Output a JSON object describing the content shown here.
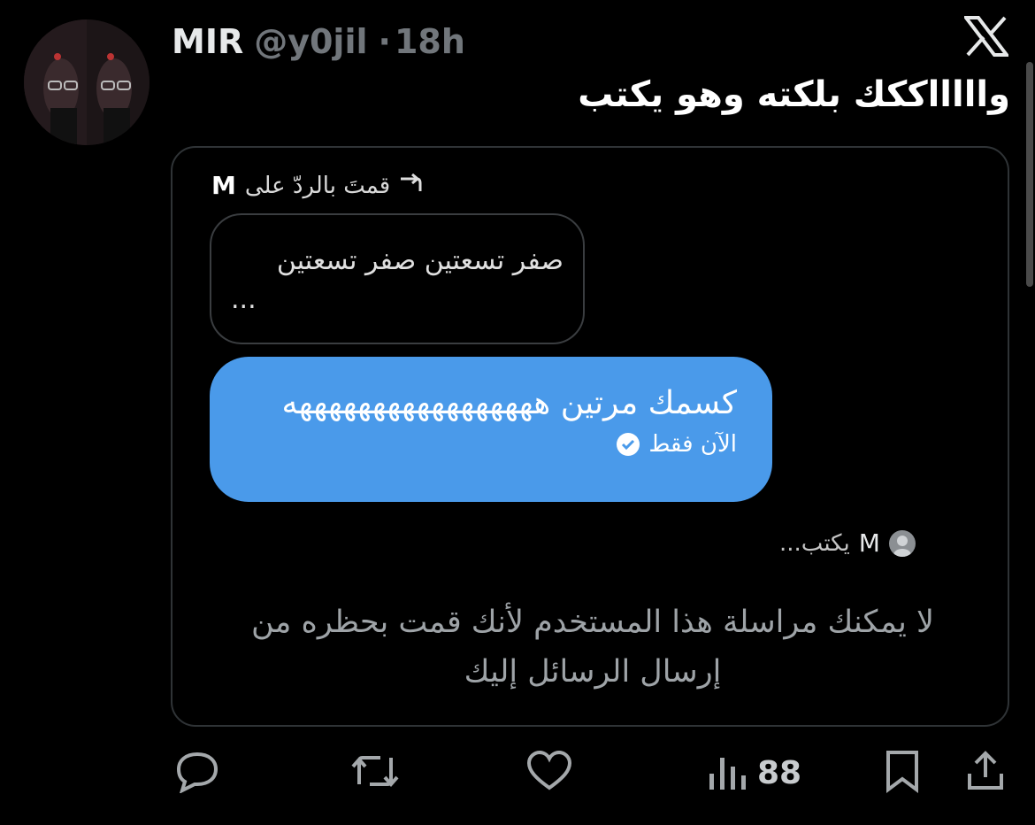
{
  "tweet": {
    "author_name": "MIR",
    "handle": "@y0jil",
    "separator": "·",
    "time": "18h",
    "text": "واااااككك بلكته وهو يكتب"
  },
  "dm_screenshot": {
    "reply_label": "قمتَ بالردّ على",
    "reply_target": "M",
    "quoted_message_line1": "صفر تسعتين صفر تسعتين",
    "quoted_message_line2": "...",
    "sent_message": "كسمك مرتين هههههههههههههههههه",
    "sent_status": "الآن فقط",
    "typing_user": "M",
    "typing_text": "يكتب...",
    "blocked_notice_line1": "لا يمكنك مراسلة هذا المستخدم لأنك قمت بحظره من",
    "blocked_notice_line2": "إرسال الرسائل إليك"
  },
  "actions": {
    "reply_icon": "reply-icon",
    "retweet_icon": "retweet-icon",
    "like_icon": "heart-icon",
    "views_icon": "views-icon",
    "views_count": "88",
    "bookmark_icon": "bookmark-icon",
    "share_icon": "share-icon"
  },
  "colors": {
    "background": "#000000",
    "bubble": "#4a9aea",
    "muted": "#71767b"
  }
}
